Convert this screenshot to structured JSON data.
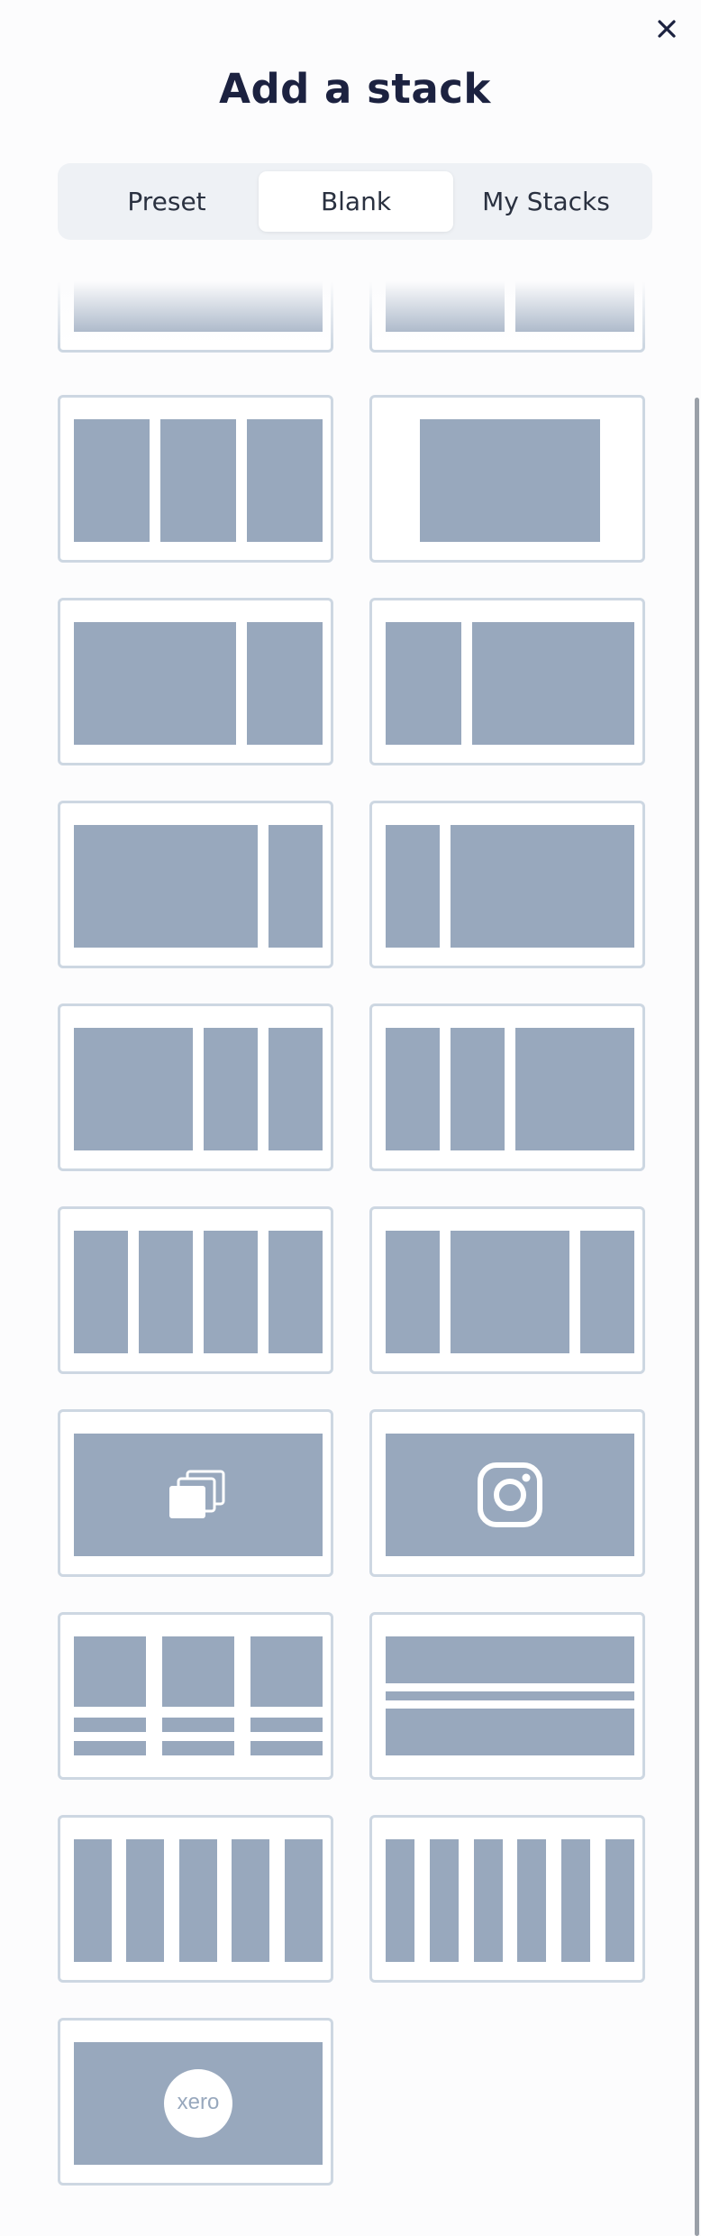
{
  "dialog": {
    "title": "Add a stack",
    "close_icon": "close-icon"
  },
  "tabs": [
    {
      "label": "Preset",
      "active": false
    },
    {
      "label": "Blank",
      "active": true
    },
    {
      "label": "My Stacks",
      "active": false
    }
  ],
  "layouts": [
    {
      "name": "layout-1-column-partial"
    },
    {
      "name": "layout-2-columns-partial"
    },
    {
      "name": "layout-3-equal-columns"
    },
    {
      "name": "layout-1-centered-column"
    },
    {
      "name": "layout-wide-left-narrow-right"
    },
    {
      "name": "layout-narrow-left-wide-right"
    },
    {
      "name": "layout-wider-left-narrow-right"
    },
    {
      "name": "layout-narrow-left-wider-right"
    },
    {
      "name": "layout-wide-left-2-narrow"
    },
    {
      "name": "layout-2-narrow-wide-right"
    },
    {
      "name": "layout-4-equal-columns"
    },
    {
      "name": "layout-narrow-wide-narrow"
    },
    {
      "name": "layout-gallery",
      "icon": "gallery-icon"
    },
    {
      "name": "layout-instagram",
      "icon": "instagram-icon"
    },
    {
      "name": "layout-3-cards-with-text"
    },
    {
      "name": "layout-2-rows-with-divider"
    },
    {
      "name": "layout-5-columns"
    },
    {
      "name": "layout-6-columns"
    },
    {
      "name": "layout-xero",
      "icon": "xero-logo",
      "logo_text": "xero"
    }
  ],
  "colors": {
    "block": "#98a8bd",
    "card_border": "#cdd7e2",
    "title": "#1c2240"
  }
}
